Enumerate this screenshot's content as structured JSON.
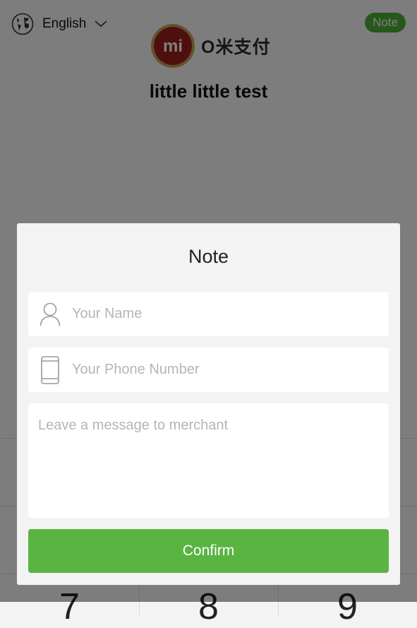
{
  "header": {
    "language_label": "English",
    "note_badge": "Note",
    "brand_logo_text": "mi",
    "brand_name": "O米支付",
    "merchant_name": "little little test"
  },
  "keypad": {
    "visible_keys": [
      "7",
      "8",
      "9"
    ]
  },
  "dialog": {
    "title": "Note",
    "name_placeholder": "Your Name",
    "phone_placeholder": "Your Phone Number",
    "message_placeholder": "Leave a message to merchant",
    "confirm_label": "Confirm"
  },
  "colors": {
    "accent_green": "#5ab442",
    "brand_red": "#a11f1f"
  },
  "icons": [
    "globe-icon",
    "chevron-down-icon",
    "user-icon",
    "phone-icon"
  ]
}
